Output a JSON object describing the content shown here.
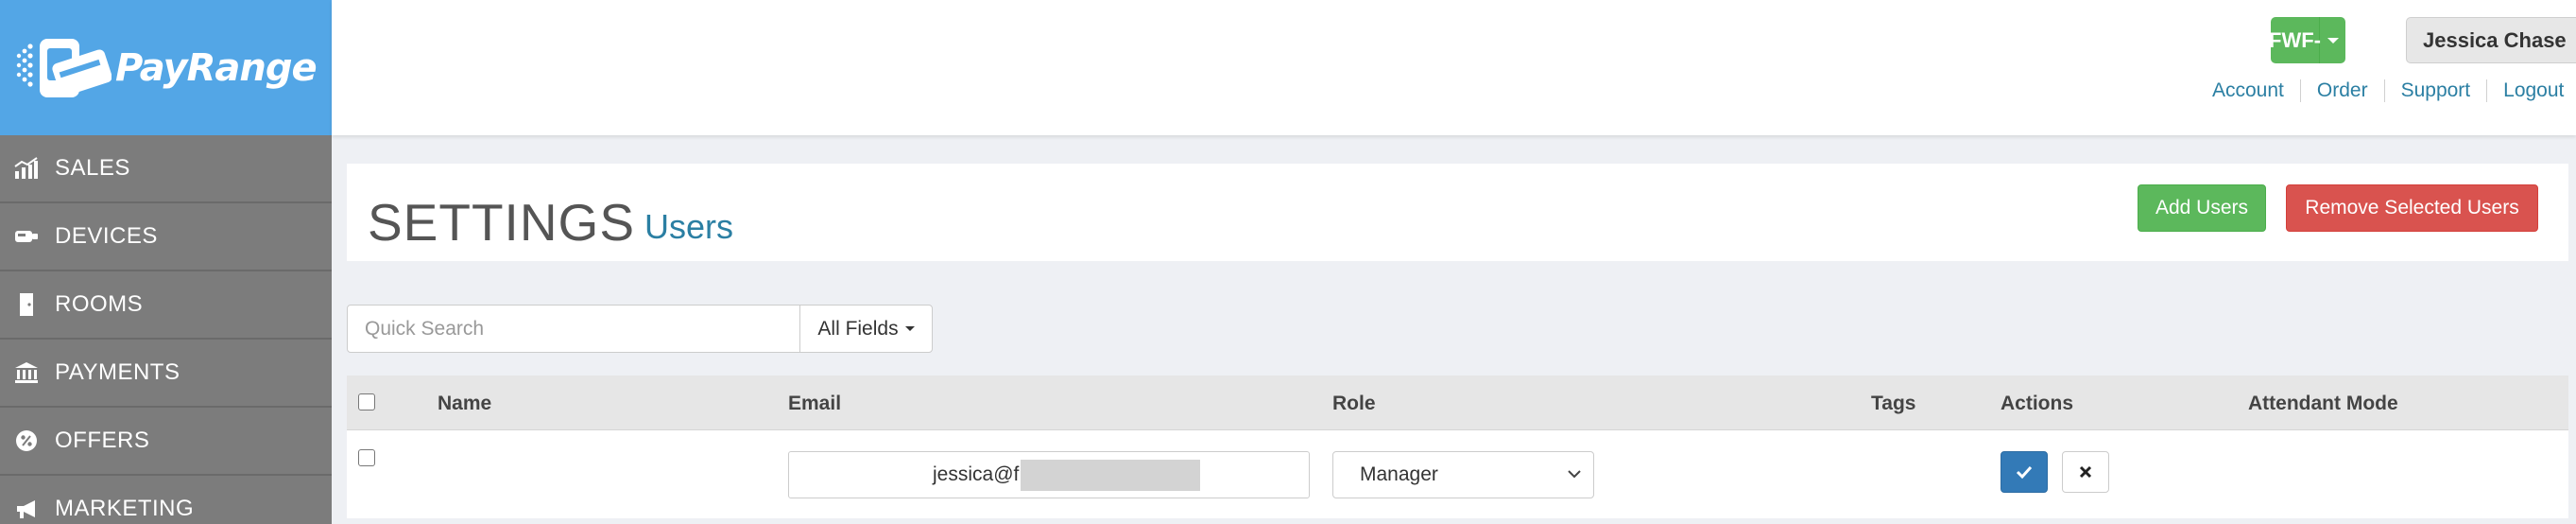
{
  "brand": {
    "name": "PayRange",
    "logo_color": "#53a6e6"
  },
  "sidebar": {
    "items": [
      {
        "label": "SALES",
        "icon": "bar-chart-icon"
      },
      {
        "label": "DEVICES",
        "icon": "device-icon"
      },
      {
        "label": "ROOMS",
        "icon": "door-icon"
      },
      {
        "label": "PAYMENTS",
        "icon": "bank-icon"
      },
      {
        "label": "OFFERS",
        "icon": "percent-badge-icon"
      },
      {
        "label": "MARKETING",
        "icon": "megaphone-icon"
      }
    ]
  },
  "header": {
    "account_selector": "FWF-",
    "user_name": "Jessica Chase",
    "links": [
      "Account",
      "Order",
      "Support",
      "Logout"
    ]
  },
  "page": {
    "title": "SETTINGS",
    "subtitle": "Users",
    "add_button": "Add Users",
    "remove_button": "Remove Selected Users"
  },
  "search": {
    "placeholder": "Quick Search",
    "field_filter": "All Fields"
  },
  "table": {
    "columns": {
      "name": "Name",
      "email": "Email",
      "role": "Role",
      "tags": "Tags",
      "actions": "Actions",
      "attendant_mode": "Attendant Mode"
    },
    "rows": [
      {
        "name": "",
        "email": "jessica@f",
        "role": "Manager",
        "tags": "",
        "attendant_mode": ""
      }
    ]
  },
  "colors": {
    "sidebar_bg": "#7c7c7c",
    "success": "#5cb85c",
    "danger": "#d9534f",
    "primary": "#337ab7",
    "link": "#2b7fa3"
  }
}
